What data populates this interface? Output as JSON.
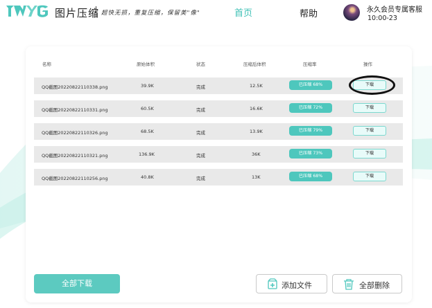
{
  "header": {
    "app_title": "图片压缩",
    "slogan": "超快无损，重复压缩，保留美\"像\"",
    "nav": {
      "home": "首页",
      "help": "帮助"
    },
    "user": {
      "name": "永久会员专属客服",
      "expire": "10:00-23"
    }
  },
  "colors": {
    "accent": "#4ec7bd",
    "nav_active": "#3fc1b6",
    "row_bg": "#e9e9e9"
  },
  "table": {
    "headers": [
      "名称",
      "原始体积",
      "状态",
      "压缩后体积",
      "压缩率",
      "操作"
    ],
    "rows": [
      {
        "name": "QQ截图20220822110338.png",
        "original": "39.9K",
        "status": "完成",
        "compressed": "12.5K",
        "rate": "已压缩 68%",
        "action": "下载"
      },
      {
        "name": "QQ截图20220822110331.png",
        "original": "60.5K",
        "status": "完成",
        "compressed": "16.6K",
        "rate": "已压缩 72%",
        "action": "下载"
      },
      {
        "name": "QQ截图20220822110326.png",
        "original": "68.5K",
        "status": "完成",
        "compressed": "13.9K",
        "rate": "已压缩 79%",
        "action": "下载"
      },
      {
        "name": "QQ截图20220822110321.png",
        "original": "136.9K",
        "status": "完成",
        "compressed": "36K",
        "rate": "已压缩 73%",
        "action": "下载"
      },
      {
        "name": "QQ截图20220822110256.png",
        "original": "40.8K",
        "status": "完成",
        "compressed": "13K",
        "rate": "已压缩 68%",
        "action": "下载"
      }
    ]
  },
  "actions": {
    "download_all": "全部下载",
    "add_file": "添加文件",
    "delete_all": "全部删除"
  },
  "icons": {
    "add": "add-file-icon",
    "delete": "trash-icon"
  }
}
